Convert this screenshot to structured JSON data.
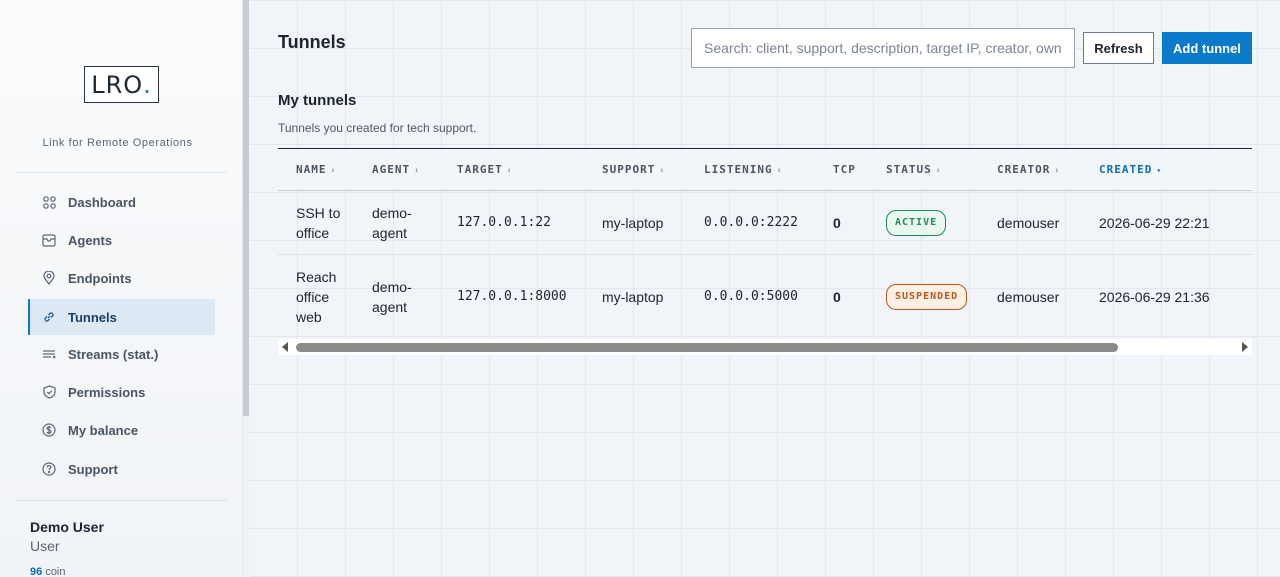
{
  "brand": {
    "logo_text": "LRO",
    "logo_dot": ".",
    "tagline": "Link for Remote Operations"
  },
  "sidebar": {
    "items": [
      {
        "label": "Dashboard",
        "icon": "grid-icon",
        "active": false
      },
      {
        "label": "Agents",
        "icon": "inbox-icon",
        "active": false
      },
      {
        "label": "Endpoints",
        "icon": "location-pin-icon",
        "active": false
      },
      {
        "label": "Tunnels",
        "icon": "link-icon",
        "active": true
      },
      {
        "label": "Streams (stat.)",
        "icon": "streams-icon",
        "active": false
      },
      {
        "label": "Permissions",
        "icon": "shield-icon",
        "active": false
      },
      {
        "label": "My balance",
        "icon": "dollar-icon",
        "active": false
      },
      {
        "label": "Support",
        "icon": "help-icon",
        "active": false
      }
    ]
  },
  "user": {
    "name": "Demo User",
    "role": "User",
    "coin_amount": "96",
    "coin_label": "coin"
  },
  "header": {
    "title": "Tunnels",
    "search_placeholder": "Search: client, support, description, target IP, creator, owner",
    "refresh_label": "Refresh",
    "add_label": "Add tunnel"
  },
  "section": {
    "title": "My tunnels",
    "subtitle": "Tunnels you created for tech support."
  },
  "table": {
    "columns": [
      "NAME",
      "AGENT",
      "TARGET",
      "SUPPORT",
      "LISTENING",
      "TCP",
      "STATUS",
      "CREATOR",
      "CREATED"
    ],
    "sorted_column": "CREATED",
    "rows": [
      {
        "name": "SSH to office",
        "agent": "demo-agent",
        "target": "127.0.0.1:22",
        "support": "my-laptop",
        "listening": "0.0.0.0:2222",
        "tcp": "0",
        "status": "ACTIVE",
        "creator": "demouser",
        "created": "2026-06-29 22:21"
      },
      {
        "name": "Reach office web",
        "agent": "demo-agent",
        "target": "127.0.0.1:8000",
        "support": "my-laptop",
        "listening": "0.0.0.0:5000",
        "tcp": "0",
        "status": "SUSPENDED",
        "creator": "demouser",
        "created": "2026-06-29 21:36"
      }
    ]
  },
  "colors": {
    "accent": "#0a7ac9",
    "active_status": "#1f8a5b",
    "suspended_status": "#b8581d"
  }
}
